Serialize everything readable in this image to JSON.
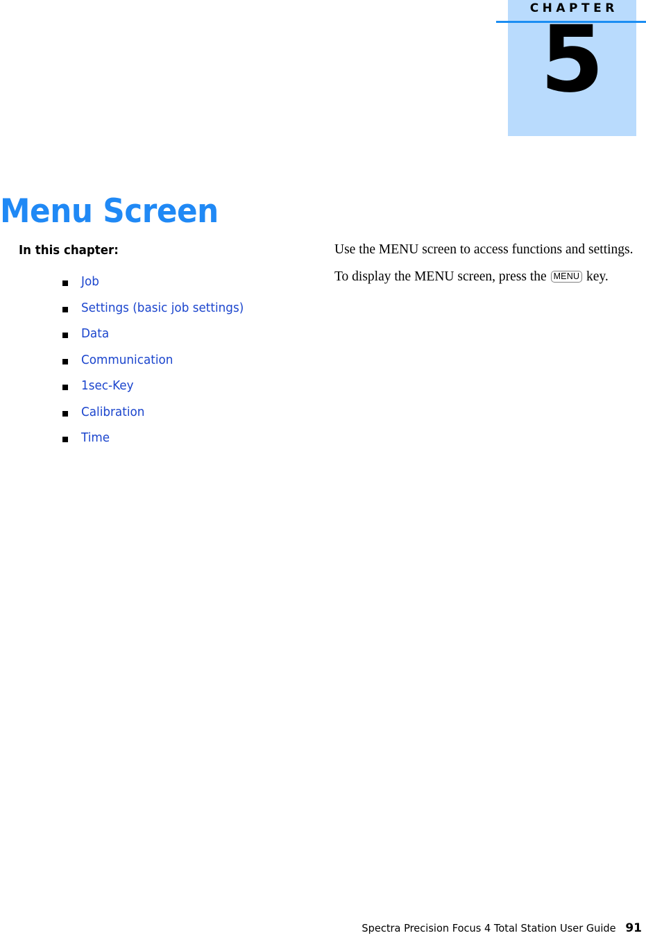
{
  "chapter_header": {
    "label": "CHAPTER",
    "number": "5",
    "box_color": "#b9dbfd",
    "rule_color": "#1b8df2"
  },
  "page_title": "Menu Screen",
  "title_color": "#2089f5",
  "left_column": {
    "heading": "In this chapter:",
    "link_color": "#1b45cd",
    "items": [
      {
        "label": "Job",
        "bullet": "square-bullet-icon"
      },
      {
        "label": "Settings (basic job settings)",
        "bullet": "square-bullet-icon"
      },
      {
        "label": "Data",
        "bullet": "square-bullet-icon"
      },
      {
        "label": "Communication",
        "bullet": "square-bullet-icon"
      },
      {
        "label": "1sec-Key",
        "bullet": "square-bullet-icon"
      },
      {
        "label": "Calibration",
        "bullet": "square-bullet-icon"
      },
      {
        "label": "Time",
        "bullet": "square-bullet-icon"
      }
    ]
  },
  "right_column": {
    "paragraph1": "Use the MENU screen to access functions and settings.",
    "paragraph2_before": "To display the MENU screen, press the ",
    "paragraph2_key": "MENU",
    "paragraph2_after": " key."
  },
  "footer": {
    "title": "Spectra Precision Focus 4 Total Station User Guide",
    "page_number": "91"
  }
}
